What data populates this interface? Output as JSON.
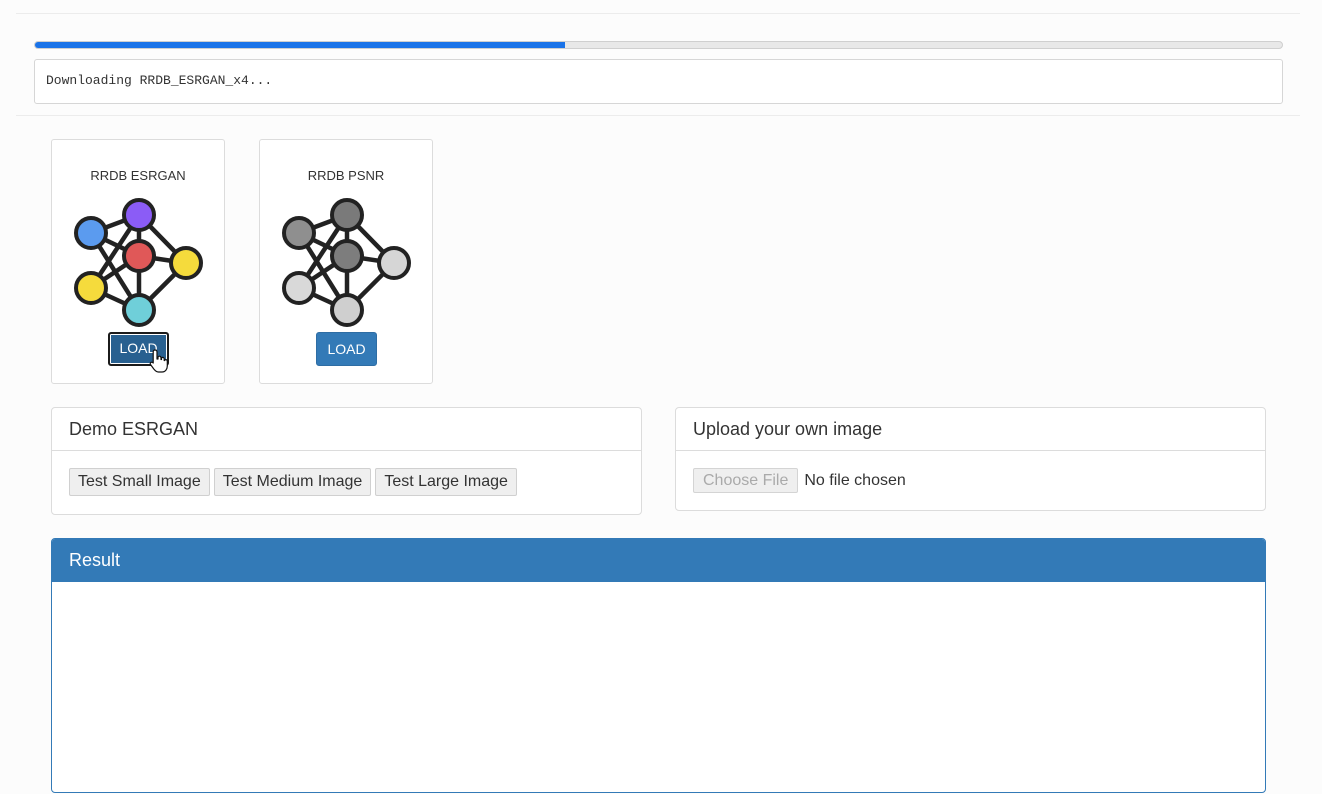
{
  "progress": {
    "fraction": 0.425
  },
  "log": {
    "text": "Downloading RRDB_ESRGAN_x4..."
  },
  "models": [
    {
      "title": "RRDB ESRGAN",
      "button": "LOAD",
      "icon": "neural-network-colored-icon"
    },
    {
      "title": "RRDB PSNR",
      "button": "LOAD",
      "icon": "neural-network-gray-icon"
    }
  ],
  "demo": {
    "title": "Demo ESRGAN",
    "buttons": [
      "Test Small Image",
      "Test Medium Image",
      "Test Large Image"
    ]
  },
  "upload": {
    "title": "Upload your own image",
    "choose_label": "Choose File",
    "file_status": "No file chosen"
  },
  "result": {
    "title": "Result"
  },
  "colors": {
    "accent": "#337ab7",
    "progress": "#1a73e8",
    "node_blue": "#5b9bef",
    "node_purple": "#8b5cf6",
    "node_red": "#e05858",
    "node_yellow": "#f5db3c",
    "node_cyan": "#6fcfd9"
  }
}
